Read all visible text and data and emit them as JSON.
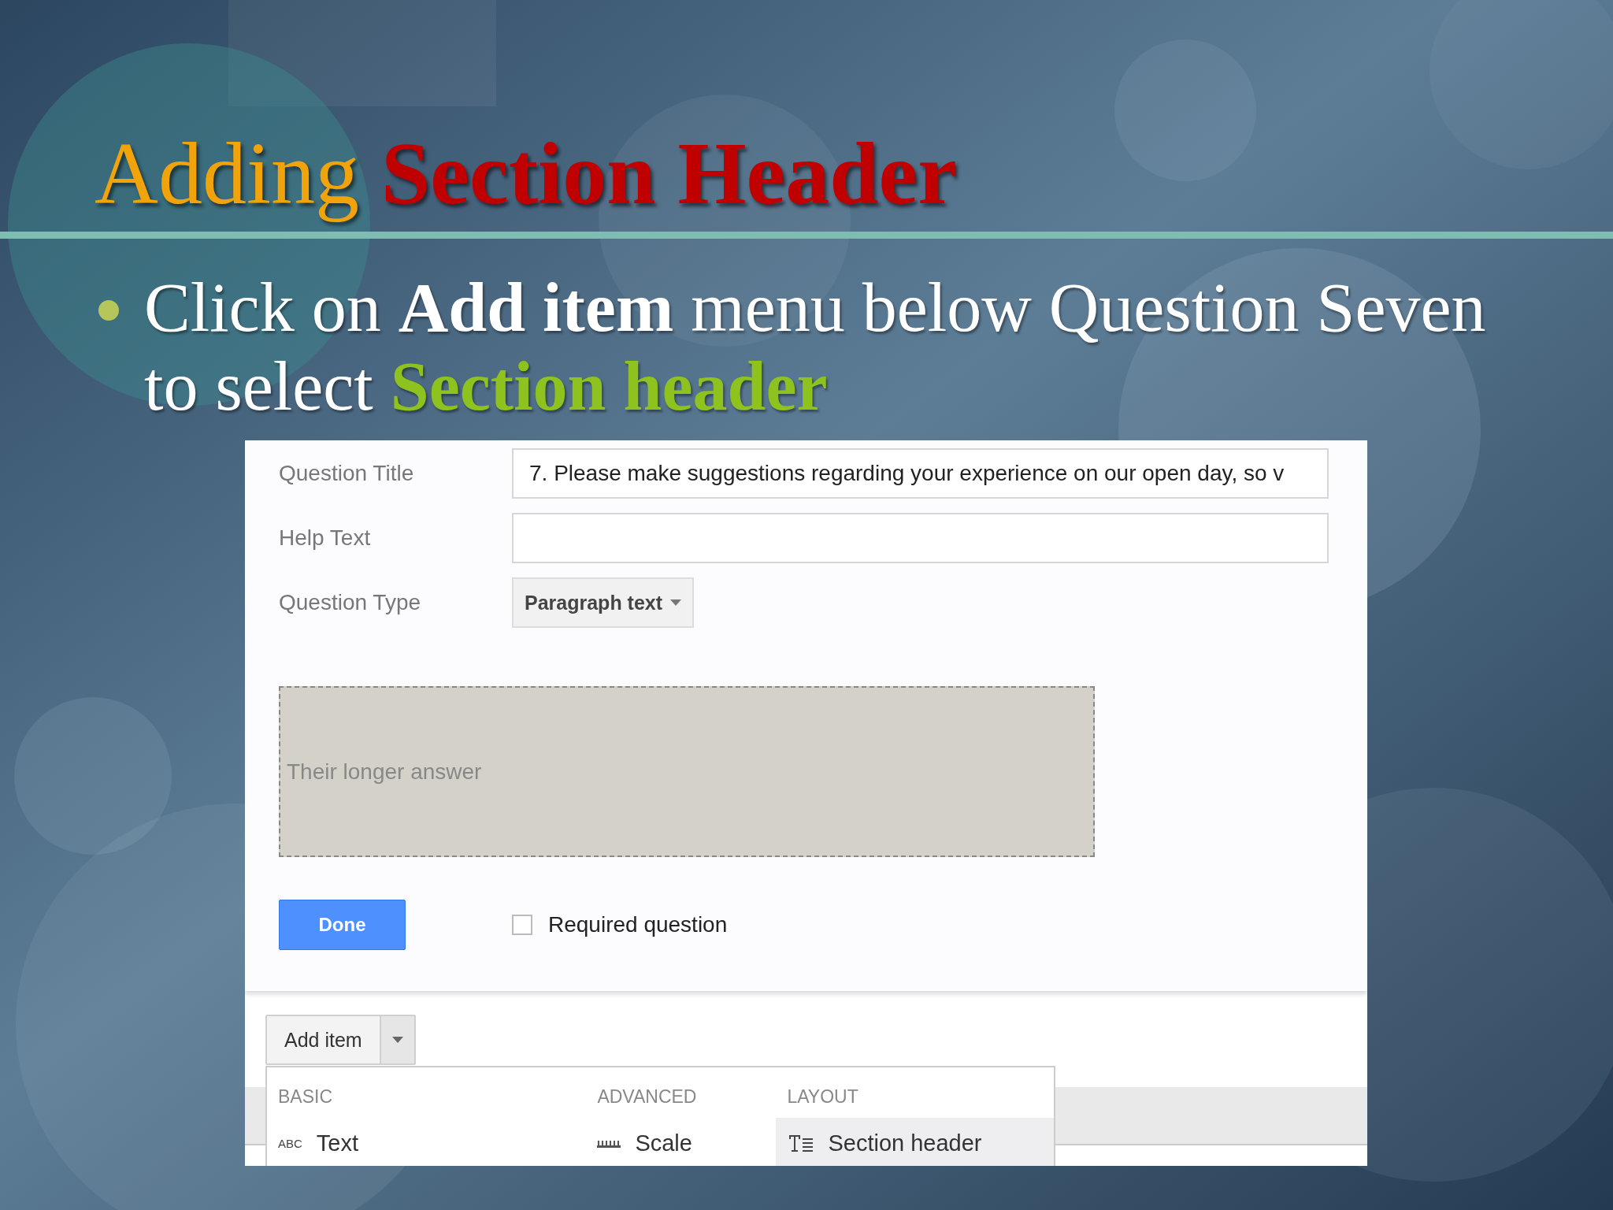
{
  "slide": {
    "title": [
      {
        "text": "Adding",
        "kind": "plain"
      },
      {
        "text": "Section Header",
        "kind": "bold"
      }
    ],
    "bullet": [
      {
        "text": "Click on ",
        "kind": "plain"
      },
      {
        "text": "Add item",
        "kind": "bold"
      },
      {
        "text": " menu below Question Seven to select ",
        "kind": "plain"
      },
      {
        "text": "Section header",
        "kind": "highlight"
      }
    ]
  },
  "form": {
    "fields": [
      {
        "label": "Question Title",
        "kind": "text",
        "value": "7. Please make suggestions regarding your experience on our open day, so v"
      },
      {
        "label": "Help Text",
        "kind": "text"
      },
      {
        "label": "Question Type",
        "kind": "select",
        "value": "Paragraph text"
      }
    ],
    "answer": {
      "placeholder": "Their longer answer"
    },
    "done_button": "Done",
    "required": {
      "label": "Required question",
      "checked": false
    }
  },
  "add_item": {
    "label": "Add item",
    "menu": [
      {
        "heading": "BASIC",
        "items": [
          {
            "label": "Text",
            "icon": "ABC",
            "selected": false
          }
        ]
      },
      {
        "heading": "ADVANCED",
        "items": [
          {
            "label": "Scale",
            "selected": false
          }
        ]
      },
      {
        "heading": "LAYOUT",
        "items": [
          {
            "label": "Section header",
            "selected": true
          }
        ]
      }
    ]
  }
}
